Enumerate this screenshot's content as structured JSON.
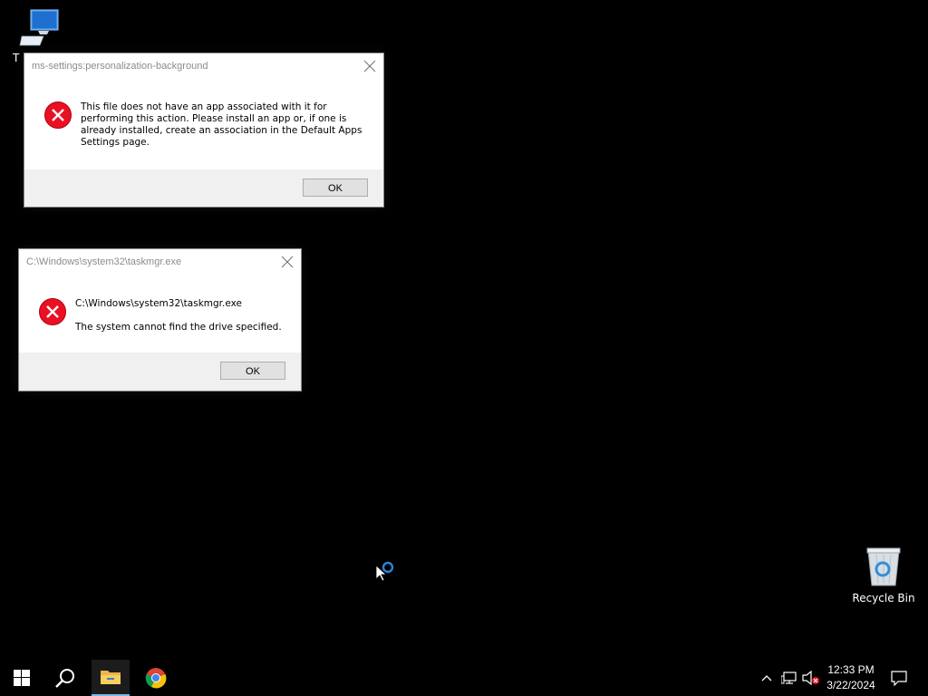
{
  "desktop": {
    "icons": [
      {
        "label": "T"
      },
      {
        "label": "Recycle Bin"
      }
    ]
  },
  "dialogs": [
    {
      "title": "ms-settings:personalization-background",
      "message": "This file does not have an app associated with it for performing this action. Please install an app or, if one is already installed, create an association in the Default Apps Settings page.",
      "ok_label": "OK"
    },
    {
      "title": "C:\\Windows\\system32\\taskmgr.exe",
      "message_line1": "C:\\Windows\\system32\\taskmgr.exe",
      "message_line2": "The system cannot find the drive specified.",
      "ok_label": "OK"
    }
  ],
  "taskbar": {
    "pinned": [
      {
        "icon": "windows-start-icon"
      },
      {
        "icon": "search-icon"
      },
      {
        "icon": "file-explorer-icon"
      },
      {
        "icon": "chrome-icon"
      }
    ],
    "tray": {
      "time": "12:33 PM",
      "date": "3/22/2024"
    }
  },
  "colors": {
    "error_red": "#e81123",
    "accent_blue": "#76b9ed"
  }
}
